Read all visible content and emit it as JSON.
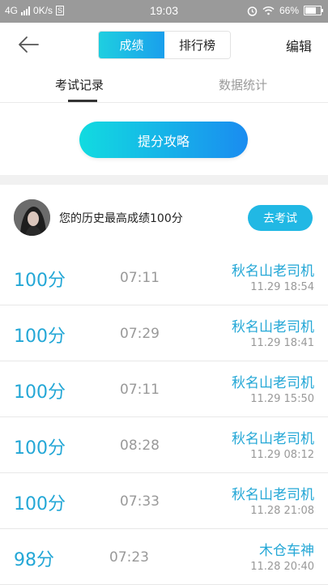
{
  "status_bar": {
    "network": "4G",
    "speed": "0K/s",
    "sim_badge": "S",
    "time": "19:03",
    "battery": "66%"
  },
  "header": {
    "segments": [
      "成绩",
      "排行榜"
    ],
    "edit_label": "编辑"
  },
  "tabs": [
    "考试记录",
    "数据统计"
  ],
  "tips_button": "提分攻略",
  "best": {
    "text": "您的历史最高成绩100分",
    "exam_button": "去考试"
  },
  "records": [
    {
      "score": "100分",
      "duration": "07:11",
      "name": "秋名山老司机",
      "date": "11.29  18:54"
    },
    {
      "score": "100分",
      "duration": "07:29",
      "name": "秋名山老司机",
      "date": "11.29  18:41"
    },
    {
      "score": "100分",
      "duration": "07:11",
      "name": "秋名山老司机",
      "date": "11.29  15:50"
    },
    {
      "score": "100分",
      "duration": "08:28",
      "name": "秋名山老司机",
      "date": "11.29  08:12"
    },
    {
      "score": "100分",
      "duration": "07:33",
      "name": "秋名山老司机",
      "date": "11.28  21:08"
    },
    {
      "score": "98分",
      "duration": "07:23",
      "name": "木仓车神",
      "date": "11.28  20:40"
    }
  ],
  "colors": {
    "accent": "#23a7d6",
    "gradient_start": "#12dbe0",
    "gradient_end": "#1a8cf0",
    "status_bar": "#9a9a9a"
  }
}
